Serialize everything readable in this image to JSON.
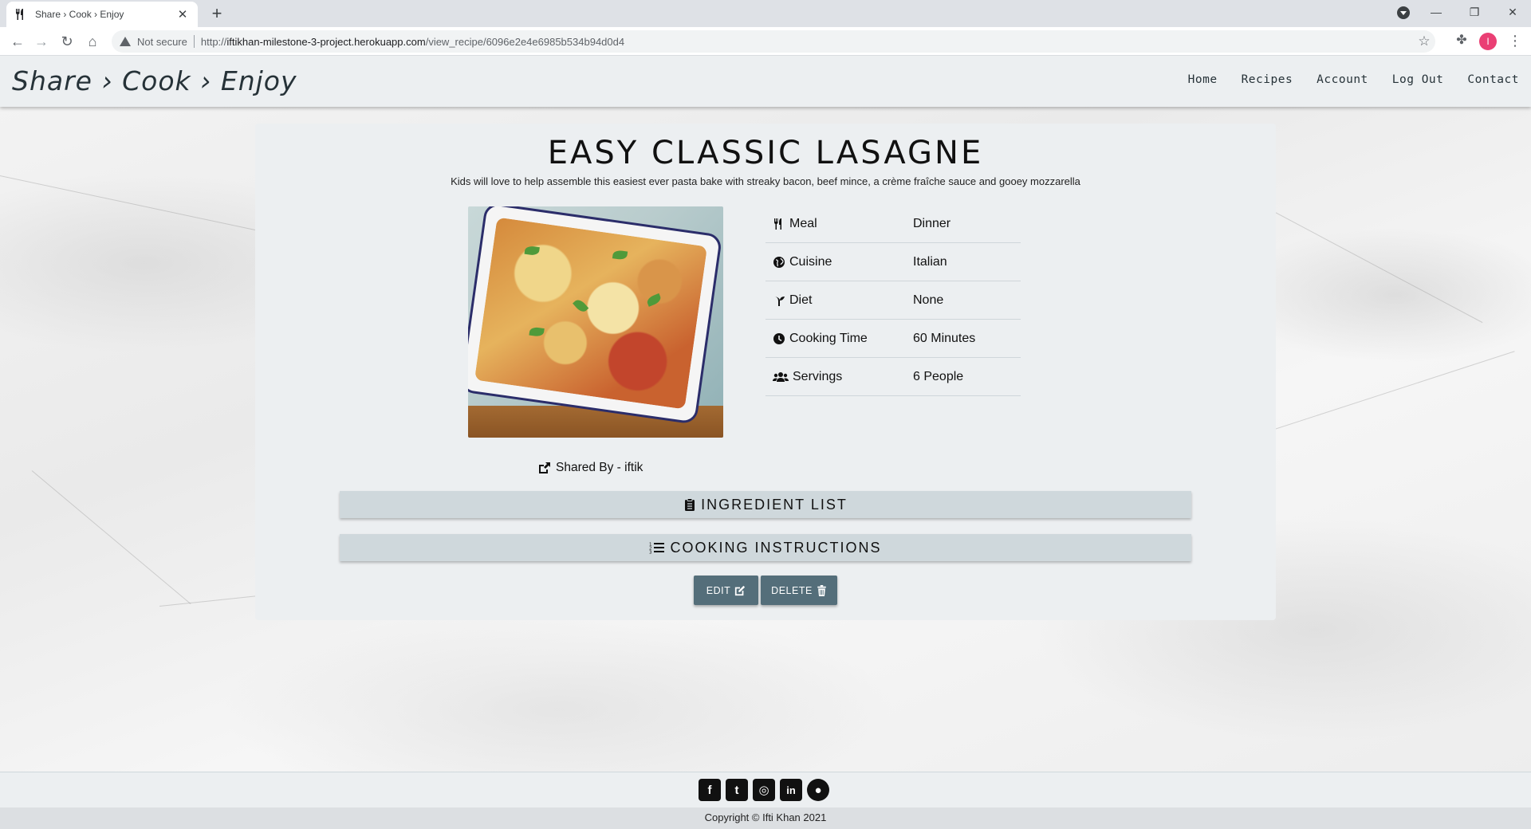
{
  "browser": {
    "tab_title": "Share › Cook › Enjoy",
    "tab_close": "✕",
    "new_tab": "+",
    "not_secure": "Not secure",
    "url_prefix": "http://",
    "url_host": "iftikhan-milestone-3-project.herokuapp.com",
    "url_path": "/view_recipe/6096e2e4e6985b534b94d0d4",
    "profile_initial": "I",
    "window_controls": {
      "minimize": "—",
      "restore": "❐",
      "close": "✕"
    }
  },
  "navbar": {
    "brand": "Share › Cook › Enjoy",
    "links": [
      "Home",
      "Recipes",
      "Account",
      "Log Out",
      "Contact"
    ]
  },
  "recipe": {
    "title": "EASY CLASSIC LASAGNE",
    "description": "Kids will love to help assemble this easiest ever pasta bake with streaky bacon, beef mince, a crème fraîche sauce and gooey mozzarella",
    "shared_by": "Shared By - iftik",
    "details": [
      {
        "icon": "utensils-icon",
        "label": "Meal",
        "value": "Dinner"
      },
      {
        "icon": "globe-icon",
        "label": "Cuisine",
        "value": "Italian"
      },
      {
        "icon": "seedling-icon",
        "label": "Diet",
        "value": "None"
      },
      {
        "icon": "clock-icon",
        "label": "Cooking Time",
        "value": "60 Minutes"
      },
      {
        "icon": "users-icon",
        "label": "Servings",
        "value": "6 People"
      }
    ],
    "ingredient_list_label": "INGREDIENT LIST",
    "cooking_instructions_label": "COOKING INSTRUCTIONS",
    "edit_label": "EDIT",
    "delete_label": "DELETE"
  },
  "footer": {
    "socials": [
      {
        "icon": "facebook-icon",
        "glyph": "f"
      },
      {
        "icon": "twitter-icon",
        "glyph": "t"
      },
      {
        "icon": "instagram-icon",
        "glyph": "◎"
      },
      {
        "icon": "linkedin-icon",
        "glyph": "in"
      },
      {
        "icon": "github-icon",
        "glyph": "●"
      }
    ],
    "copyright": "Copyright © Ifti Khan 2021"
  },
  "colors": {
    "navbar_bg": "#eceff1",
    "card_bg": "#eceff1",
    "collapsible_bg": "#cfd8dc",
    "button_bg": "#546e7a",
    "profile_bg": "#ea3f74"
  }
}
